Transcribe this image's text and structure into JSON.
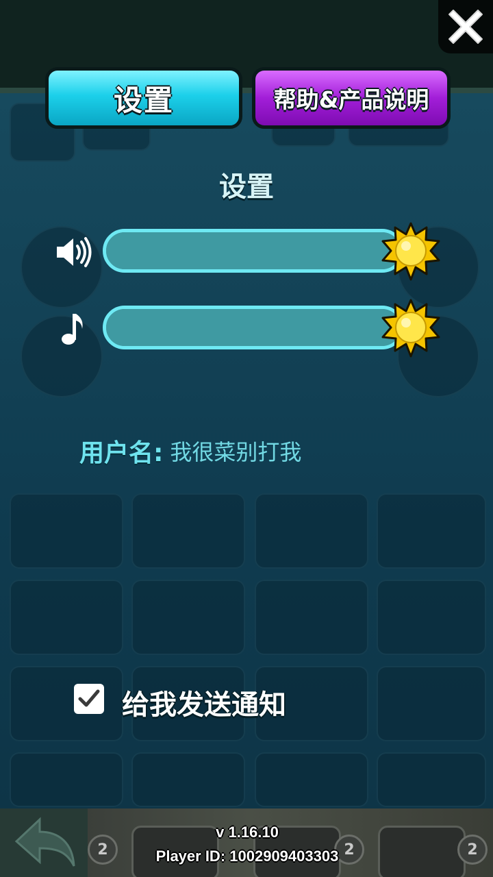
{
  "tabs": {
    "settings_label": "设置",
    "help_label": "帮助&产品说明"
  },
  "settings": {
    "heading": "设置",
    "sound_volume": 1.0,
    "music_volume": 1.0,
    "sound_icon": "speaker-icon",
    "music_icon": "music-note-icon",
    "knob_icon": "sun-icon"
  },
  "username": {
    "label": "用户名:",
    "value": "我很菜别打我"
  },
  "notifications": {
    "label": "给我发送通知",
    "checked": true
  },
  "footer": {
    "version": "v 1.16.10",
    "player_id": "Player ID: 1002909403303"
  },
  "colors": {
    "settings_tab": "#1cd0ea",
    "help_tab": "#a21ed8",
    "slider_border": "#6ee9f3",
    "username_text": "#6fe3ee"
  }
}
